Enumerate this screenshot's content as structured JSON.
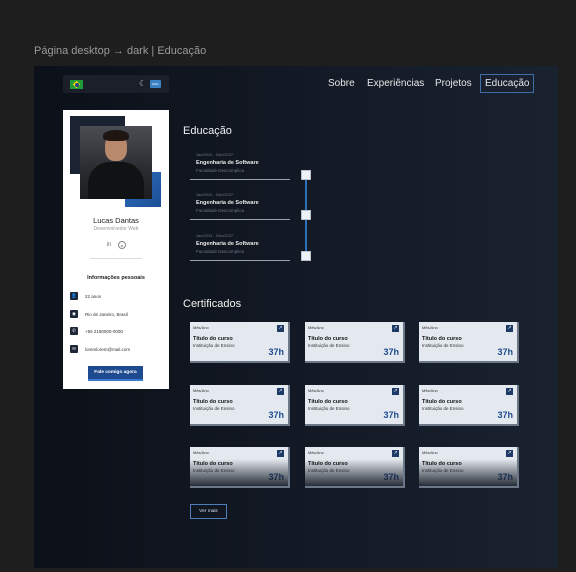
{
  "frame_label": "Página desktop → dark | Educação",
  "topbar": {
    "flag_icon": "brazil-flag-icon",
    "theme_icon": "moon-icon",
    "lang_badge": "ENG"
  },
  "nav": {
    "sobre": "Sobre",
    "experiencias": "Experiências",
    "projetos": "Projetos",
    "educacao": "Educação",
    "active": "educacao",
    "active_color": "#3f6fa8"
  },
  "profile": {
    "name": "Lucas Dantas",
    "role": "Desenvolvedor Web",
    "social": {
      "linkedin": "in",
      "github": "gh"
    },
    "info_title": "Informações pessoais",
    "info": {
      "age": "22 anos",
      "location": "Rio de Janeiro, Brasil",
      "phone": "+55 2190000-0000",
      "email": "loremlorem@mail.com"
    },
    "contact_button": "Fale comigo agora"
  },
  "education": {
    "title": "Educação",
    "items": [
      {
        "date": "Jan/2024 - Dez/2027",
        "course": "Engenharia de Software",
        "school": "Faculdade Descomplica"
      },
      {
        "date": "Jan/2024 - Dez/2027",
        "course": "Engenharia de Software",
        "school": "Faculdade Descomplica"
      },
      {
        "date": "Jan/2024 - Dez/2027",
        "course": "Engenharia de Software",
        "school": "Faculdade Descomplica"
      }
    ]
  },
  "certificates": {
    "title": "Certificados",
    "items": [
      {
        "month": "Mês/Ano",
        "course": "Título do curso",
        "school": "Instituição de Ensino",
        "hours": "37h"
      },
      {
        "month": "Mês/Ano",
        "course": "Título do curso",
        "school": "Instituição de Ensino",
        "hours": "37h"
      },
      {
        "month": "Mês/Ano",
        "course": "Título do curso",
        "school": "Instituição de Ensino",
        "hours": "37h"
      },
      {
        "month": "Mês/Ano",
        "course": "Título do curso",
        "school": "Instituição de Ensino",
        "hours": "37h"
      },
      {
        "month": "Mês/Ano",
        "course": "Título do curso",
        "school": "Instituição de Ensino",
        "hours": "37h"
      },
      {
        "month": "Mês/Ano",
        "course": "Título do curso",
        "school": "Instituição de Ensino",
        "hours": "37h"
      },
      {
        "month": "Mês/Ano",
        "course": "Título do curso",
        "school": "Instituição de Ensino",
        "hours": "37h"
      },
      {
        "month": "Mês/Ano",
        "course": "Título do curso",
        "school": "Instituição de Ensino",
        "hours": "37h"
      },
      {
        "month": "Mês/Ano",
        "course": "Título do curso",
        "school": "Instituição de Ensino",
        "hours": "37h"
      }
    ],
    "see_more": "Ver mais"
  }
}
